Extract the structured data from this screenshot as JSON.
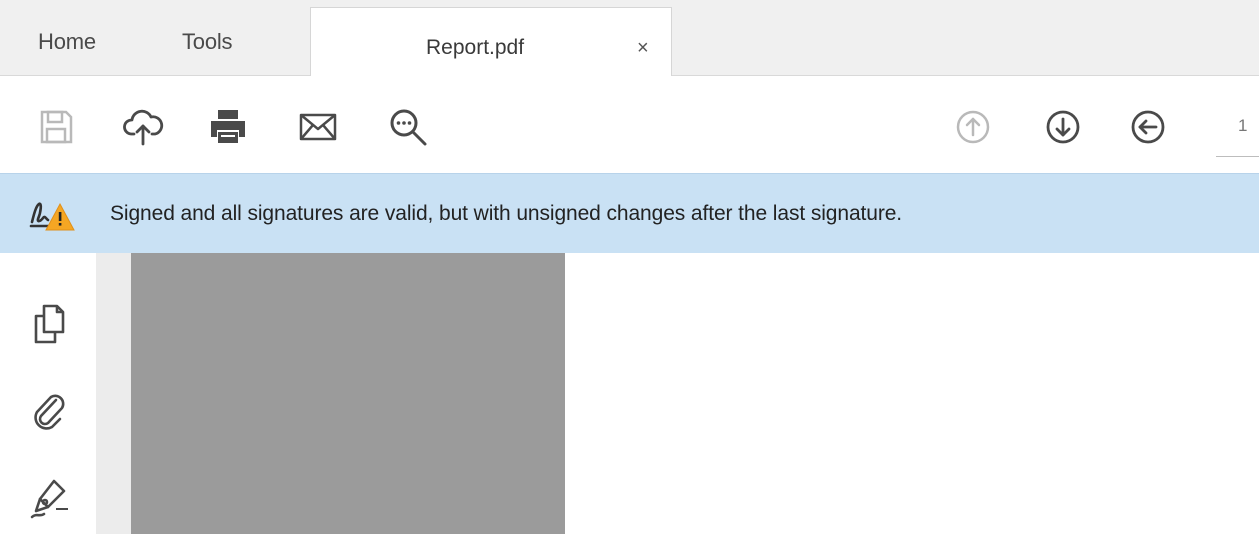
{
  "tabbar": {
    "home_label": "Home",
    "tools_label": "Tools",
    "document_tab": {
      "label": "Report.pdf",
      "close_label": "×"
    }
  },
  "toolbar": {
    "icons": [
      "save-icon",
      "upload-cloud-icon",
      "print-icon",
      "mail-icon",
      "search-comment-icon",
      "page-up-icon",
      "page-down-icon",
      "back-icon"
    ],
    "page_number": "1"
  },
  "info_bar": {
    "icon": "signature-warning-icon",
    "message": "Signed and all signatures are valid, but with unsigned changes after the last signature."
  },
  "left_rail": {
    "icons": [
      "pages-icon",
      "attachment-icon",
      "signature-pen-icon"
    ]
  },
  "colors": {
    "info_bar_bg": "#c9e1f4",
    "warning": "#f5a623",
    "icon": "#4a4a4a"
  }
}
